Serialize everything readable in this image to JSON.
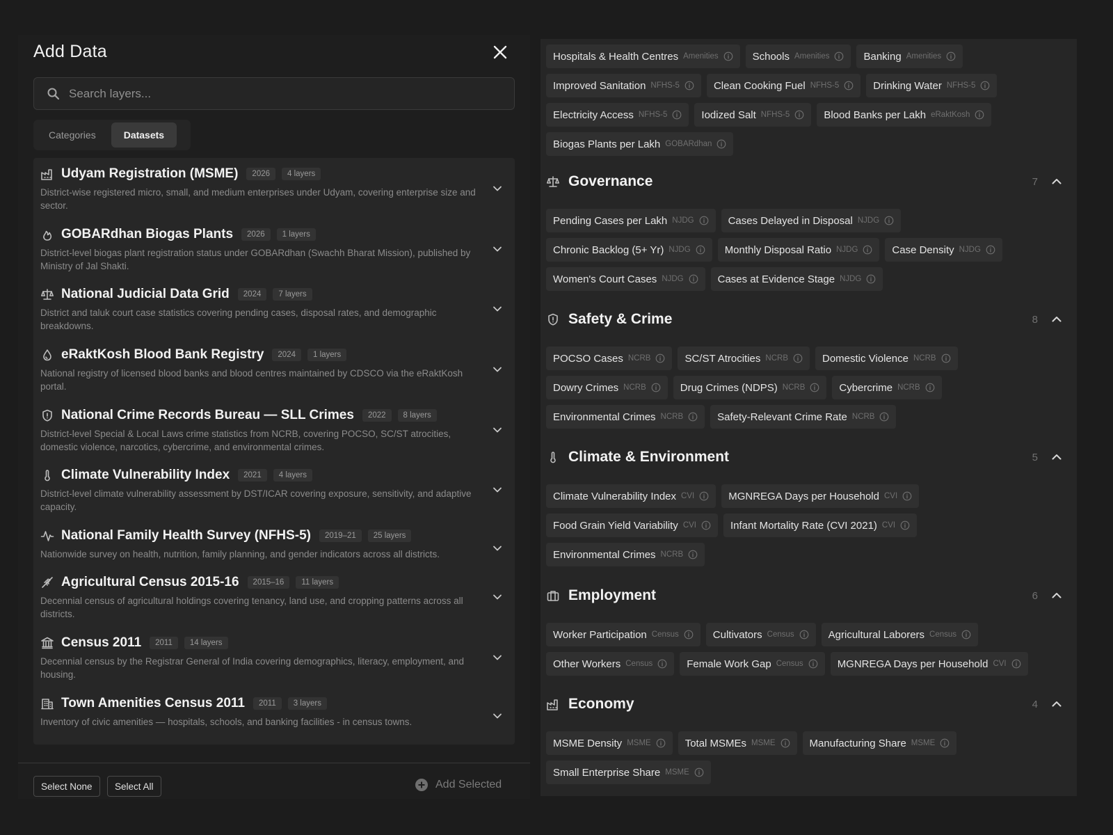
{
  "modal": {
    "title": "Add Data",
    "search_placeholder": "Search layers...",
    "tabs": [
      "Categories",
      "Datasets"
    ],
    "active_tab": "Datasets",
    "datasets": [
      {
        "name": "Udyam Registration (MSME)",
        "year": "2026",
        "layers": "4 layers",
        "description": "District-wise registered micro, small, and medium enterprises under Udyam, covering enterprise size and sector.",
        "icon": "factory-icon"
      },
      {
        "name": "GOBARdhan Biogas Plants",
        "year": "2026",
        "layers": "1 layers",
        "description": "District-level biogas plant registration status under GOBARdhan (Swachh Bharat Mission), published by Ministry of Jal Shakti.",
        "icon": "flame-icon"
      },
      {
        "name": "National Judicial Data Grid",
        "year": "2024",
        "layers": "7 layers",
        "description": "District and taluk court case statistics covering pending cases, disposal rates, and demographic breakdowns.",
        "icon": "scale-icon"
      },
      {
        "name": "eRaktKosh Blood Bank Registry",
        "year": "2024",
        "layers": "1 layers",
        "description": "National registry of licensed blood banks and blood centres maintained by CDSCO via the eRaktKosh portal.",
        "icon": "blood-drop-icon"
      },
      {
        "name": "National Crime Records Bureau — SLL Crimes",
        "year": "2022",
        "layers": "8 layers",
        "description": "District-level Special & Local Laws crime statistics from NCRB, covering POCSO, SC/ST atrocities, domestic violence, narcotics, cybercrime, and environmental crimes.",
        "icon": "shield-icon"
      },
      {
        "name": "Climate Vulnerability Index",
        "year": "2021",
        "layers": "4 layers",
        "description": "District-level climate vulnerability assessment by DST/ICAR covering exposure, sensitivity, and adaptive capacity.",
        "icon": "thermometer-icon"
      },
      {
        "name": "National Family Health Survey (NFHS-5)",
        "year": "2019–21",
        "layers": "25 layers",
        "description": "Nationwide survey on health, nutrition, family planning, and gender indicators across all districts.",
        "icon": "pulse-icon"
      },
      {
        "name": "Agricultural Census 2015-16",
        "year": "2015–16",
        "layers": "11 layers",
        "description": "Decennial census of agricultural holdings covering tenancy, land use, and cropping patterns across all districts.",
        "icon": "wheat-icon"
      },
      {
        "name": "Census 2011",
        "year": "2011",
        "layers": "14 layers",
        "description": "Decennial census by the Registrar General of India covering demographics, literacy, employment, and housing.",
        "icon": "landmark-icon"
      },
      {
        "name": "Town Amenities Census 2011",
        "year": "2011",
        "layers": "3 layers",
        "description": "Inventory of civic amenities — hospitals, schools, and banking facilities - in census towns.",
        "icon": "building-icon"
      }
    ],
    "footer": {
      "select_none": "Select None",
      "select_all": "Select All",
      "add_selected": "Add Selected"
    }
  },
  "panel": {
    "top_chips": [
      {
        "label": "Hospitals & Health Centres",
        "source": "Amenities"
      },
      {
        "label": "Schools",
        "source": "Amenities"
      },
      {
        "label": "Banking",
        "source": "Amenities"
      },
      {
        "label": "Improved Sanitation",
        "source": "NFHS-5"
      },
      {
        "label": "Clean Cooking Fuel",
        "source": "NFHS-5"
      },
      {
        "label": "Drinking Water",
        "source": "NFHS-5"
      },
      {
        "label": "Electricity Access",
        "source": "NFHS-5"
      },
      {
        "label": "Iodized Salt",
        "source": "NFHS-5"
      },
      {
        "label": "Blood Banks per Lakh",
        "source": "eRaktKosh"
      },
      {
        "label": "Biogas Plants per Lakh",
        "source": "GOBARdhan"
      }
    ],
    "sections": [
      {
        "title": "Governance",
        "count": "7",
        "icon": "scale-icon",
        "chips": [
          {
            "label": "Pending Cases per Lakh",
            "source": "NJDG"
          },
          {
            "label": "Cases Delayed in Disposal",
            "source": "NJDG"
          },
          {
            "label": "Chronic Backlog (5+ Yr)",
            "source": "NJDG"
          },
          {
            "label": "Monthly Disposal Ratio",
            "source": "NJDG"
          },
          {
            "label": "Case Density",
            "source": "NJDG"
          },
          {
            "label": "Women's Court Cases",
            "source": "NJDG"
          },
          {
            "label": "Cases at Evidence Stage",
            "source": "NJDG"
          }
        ]
      },
      {
        "title": "Safety & Crime",
        "count": "8",
        "icon": "shield-icon",
        "chips": [
          {
            "label": "POCSO Cases",
            "source": "NCRB"
          },
          {
            "label": "SC/ST Atrocities",
            "source": "NCRB"
          },
          {
            "label": "Domestic Violence",
            "source": "NCRB"
          },
          {
            "label": "Dowry Crimes",
            "source": "NCRB"
          },
          {
            "label": "Drug Crimes (NDPS)",
            "source": "NCRB"
          },
          {
            "label": "Cybercrime",
            "source": "NCRB"
          },
          {
            "label": "Environmental Crimes",
            "source": "NCRB"
          },
          {
            "label": "Safety-Relevant Crime Rate",
            "source": "NCRB"
          }
        ]
      },
      {
        "title": "Climate & Environment",
        "count": "5",
        "icon": "thermometer-icon",
        "chips": [
          {
            "label": "Climate Vulnerability Index",
            "source": "CVI"
          },
          {
            "label": "MGNREGA Days per Household",
            "source": "CVI"
          },
          {
            "label": "Food Grain Yield Variability",
            "source": "CVI"
          },
          {
            "label": "Infant Mortality Rate (CVI 2021)",
            "source": "CVI"
          },
          {
            "label": "Environmental Crimes",
            "source": "NCRB"
          }
        ]
      },
      {
        "title": "Employment",
        "count": "6",
        "icon": "briefcase-icon",
        "chips": [
          {
            "label": "Worker Participation",
            "source": "Census"
          },
          {
            "label": "Cultivators",
            "source": "Census"
          },
          {
            "label": "Agricultural Laborers",
            "source": "Census"
          },
          {
            "label": "Other Workers",
            "source": "Census"
          },
          {
            "label": "Female Work Gap",
            "source": "Census"
          },
          {
            "label": "MGNREGA Days per Household",
            "source": "CVI"
          }
        ]
      },
      {
        "title": "Economy",
        "count": "4",
        "icon": "factory-icon",
        "chips": [
          {
            "label": "MSME Density",
            "source": "MSME"
          },
          {
            "label": "Total MSMEs",
            "source": "MSME"
          },
          {
            "label": "Manufacturing Share",
            "source": "MSME"
          },
          {
            "label": "Small Enterprise Share",
            "source": "MSME"
          }
        ]
      }
    ]
  }
}
